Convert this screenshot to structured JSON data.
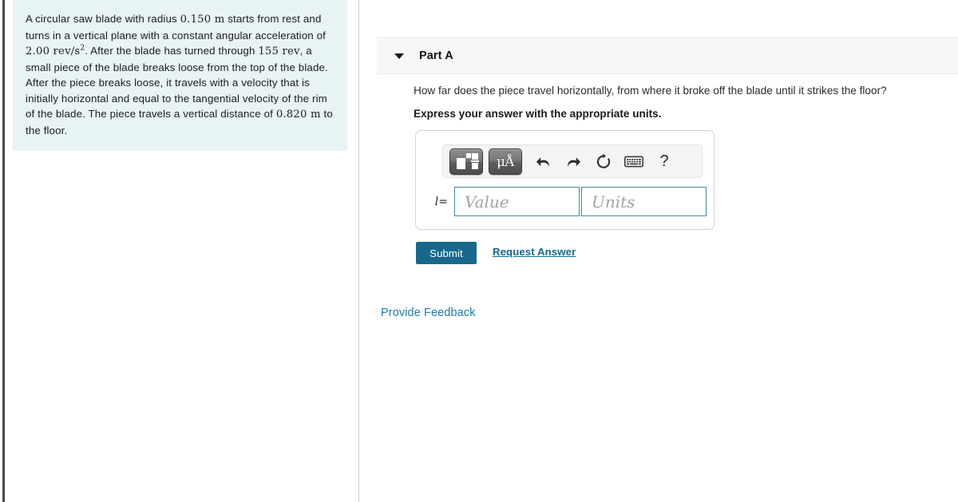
{
  "problem": {
    "text_segments": [
      {
        "type": "plain",
        "text": "A circular saw blade with radius "
      },
      {
        "type": "math",
        "text": "0.150 m"
      },
      {
        "type": "plain",
        "text": " starts from rest and turns in a vertical plane with a constant angular acceleration of "
      },
      {
        "type": "math_sup",
        "text": "2.00 rev/s",
        "sup": "2"
      },
      {
        "type": "plain",
        "text": ". After the blade has turned through "
      },
      {
        "type": "math",
        "text": "155 rev"
      },
      {
        "type": "plain",
        "text": ", a small piece of the blade breaks loose from the top of the blade. After the piece breaks loose, it travels with a velocity that is initially horizontal and equal to the tangential velocity of the rim of the blade. The piece travels a vertical distance of "
      },
      {
        "type": "math",
        "text": "0.820 m"
      },
      {
        "type": "plain",
        "text": " to the floor."
      }
    ],
    "full_text": "A circular saw blade with radius 0.150 m starts from rest and turns in a vertical plane with a constant angular acceleration of 2.00 rev/s². After the blade has turned through 155 rev, a small piece of the blade breaks loose from the top of the blade. After the piece breaks loose, it travels with a velocity that is initially horizontal and equal to the tangential velocity of the rim of the blade. The piece travels a vertical distance of 0.820 m to the floor.",
    "panel_color": "#e7f3f4"
  },
  "part": {
    "title": "Part A",
    "collapse_icon": "caret-down-icon",
    "question": "How far does the piece travel horizontally, from where it broke off the blade until it strikes the floor?",
    "instruction": "Express your answer with the appropriate units."
  },
  "answer_widget": {
    "variable_label": "l",
    "equals_sign": "=",
    "value_placeholder": "Value",
    "value_current": "",
    "units_placeholder": "Units",
    "units_current": "",
    "field_border_color": "#3d8aa8",
    "toolbar": [
      {
        "name": "math-template-button",
        "label": "",
        "icon": "math-template-icon",
        "style": "raised"
      },
      {
        "name": "units-button",
        "label": "μÅ",
        "icon": "micro-angstrom-icon",
        "style": "raised"
      },
      {
        "name": "undo-button",
        "label": "",
        "icon": "undo-arrow-icon",
        "style": "flat"
      },
      {
        "name": "redo-button",
        "label": "",
        "icon": "redo-arrow-icon",
        "style": "flat"
      },
      {
        "name": "reset-button",
        "label": "",
        "icon": "refresh-circular-arrow-icon",
        "style": "flat"
      },
      {
        "name": "keyboard-button",
        "label": "",
        "icon": "keyboard-icon",
        "style": "flat"
      },
      {
        "name": "help-button",
        "label": "?",
        "icon": "question-mark-icon",
        "style": "flat"
      }
    ]
  },
  "actions": {
    "submit_label": "Submit",
    "submit_color": "#17688c",
    "request_answer_label": "Request Answer",
    "request_answer_color": "#16698d",
    "provide_feedback_label": "Provide Feedback",
    "provide_feedback_color": "#1a7fa8"
  }
}
